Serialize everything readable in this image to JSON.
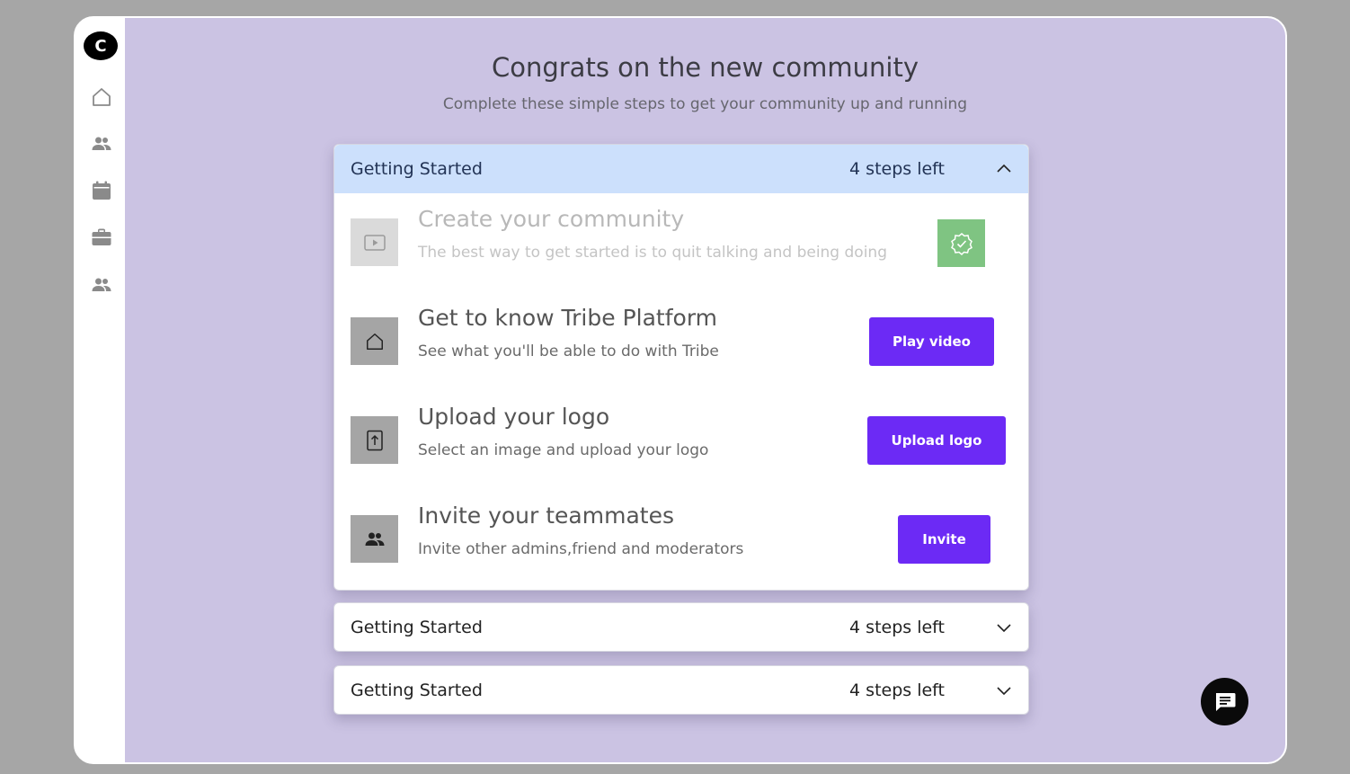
{
  "sidebar": {
    "logo_letter": "C",
    "icons": [
      "home-icon",
      "members-icon",
      "calendar-icon",
      "briefcase-icon",
      "people-icon"
    ]
  },
  "main": {
    "title": "Congrats on the new community",
    "subtitle": "Complete these simple steps to get your community up and running"
  },
  "sections": [
    {
      "title": "Getting Started",
      "steps_left": "4 steps left",
      "expanded": true,
      "steps": [
        {
          "title": "Create your community",
          "description": "The best way to get started is to quit talking and being doing",
          "icon": "play-icon",
          "completed": true,
          "status_icon": "check-badge-icon"
        },
        {
          "title": "Get to know Tribe Platform",
          "description": "See what you'll be able to do with Tribe",
          "icon": "home-icon",
          "button": "Play video"
        },
        {
          "title": "Upload your logo",
          "description": "Select an image and upload your logo",
          "icon": "upload-icon",
          "button": "Upload logo"
        },
        {
          "title": "Invite your teammates",
          "description": "Invite other admins,friend and moderators",
          "icon": "people-icon",
          "button": "Invite"
        }
      ]
    },
    {
      "title": "Getting Started",
      "steps_left": "4 steps left",
      "expanded": false
    },
    {
      "title": "Getting Started",
      "steps_left": "4 steps left",
      "expanded": false
    }
  ],
  "chat": {
    "icon": "chat-icon"
  },
  "colors": {
    "background": "#cbc3e3",
    "accent": "#6c2af5",
    "header_open": "#cce0fc",
    "success": "#7fc482"
  }
}
